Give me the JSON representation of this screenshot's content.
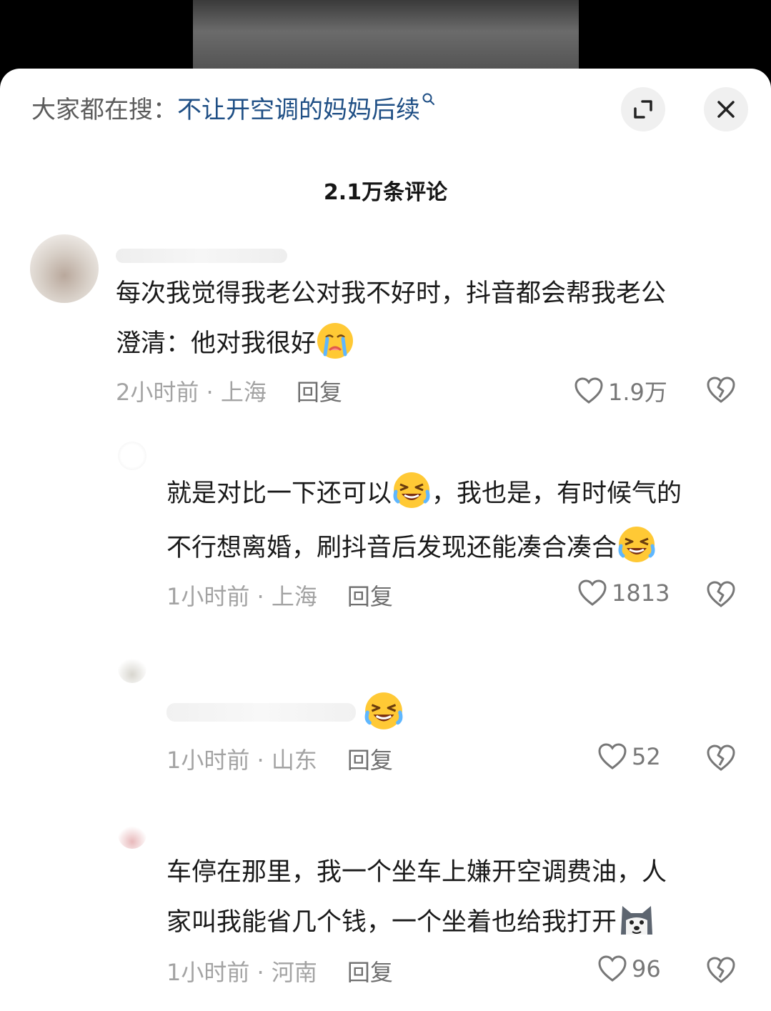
{
  "header": {
    "search_prefix": "大家都在搜：",
    "search_term": "不让开空调的妈妈后续",
    "comment_count": "2.1万条评论"
  },
  "comments": [
    {
      "text_a": "每次我觉得我老公对我不好时，抖音都会帮我老公",
      "text_b": "澄清：他对我很好",
      "emoji": "crying-face-emoji",
      "time": "2小时前",
      "location": "上海",
      "reply": "回复",
      "likes": "1.9万"
    },
    {
      "text_a": "就是对比一下还可以",
      "text_b": "，我也是，有时候气的",
      "text_c": "不行想离婚，刷抖音后发现还能凑合凑合",
      "emoji": "laughing-tears-emoji",
      "time": "1小时前",
      "location": "上海",
      "reply": "回复",
      "likes": "1813"
    },
    {
      "emoji": "laughing-tears-emoji",
      "time": "1小时前",
      "location": "山东",
      "reply": "回复",
      "likes": "52"
    },
    {
      "text_a": "车停在那里，我一个坐车上嫌开空调费油，人",
      "text_b": "家叫我能省几个钱，一个坐着也给我打开",
      "emoji": "doge-emoji",
      "time": "1小时前",
      "location": "河南",
      "reply": "回复",
      "likes": "96"
    }
  ],
  "separator": " · ",
  "colors": {
    "link_blue": "#1f4f85",
    "meta_gray": "#a3a3a3",
    "background": "#ffffff"
  }
}
